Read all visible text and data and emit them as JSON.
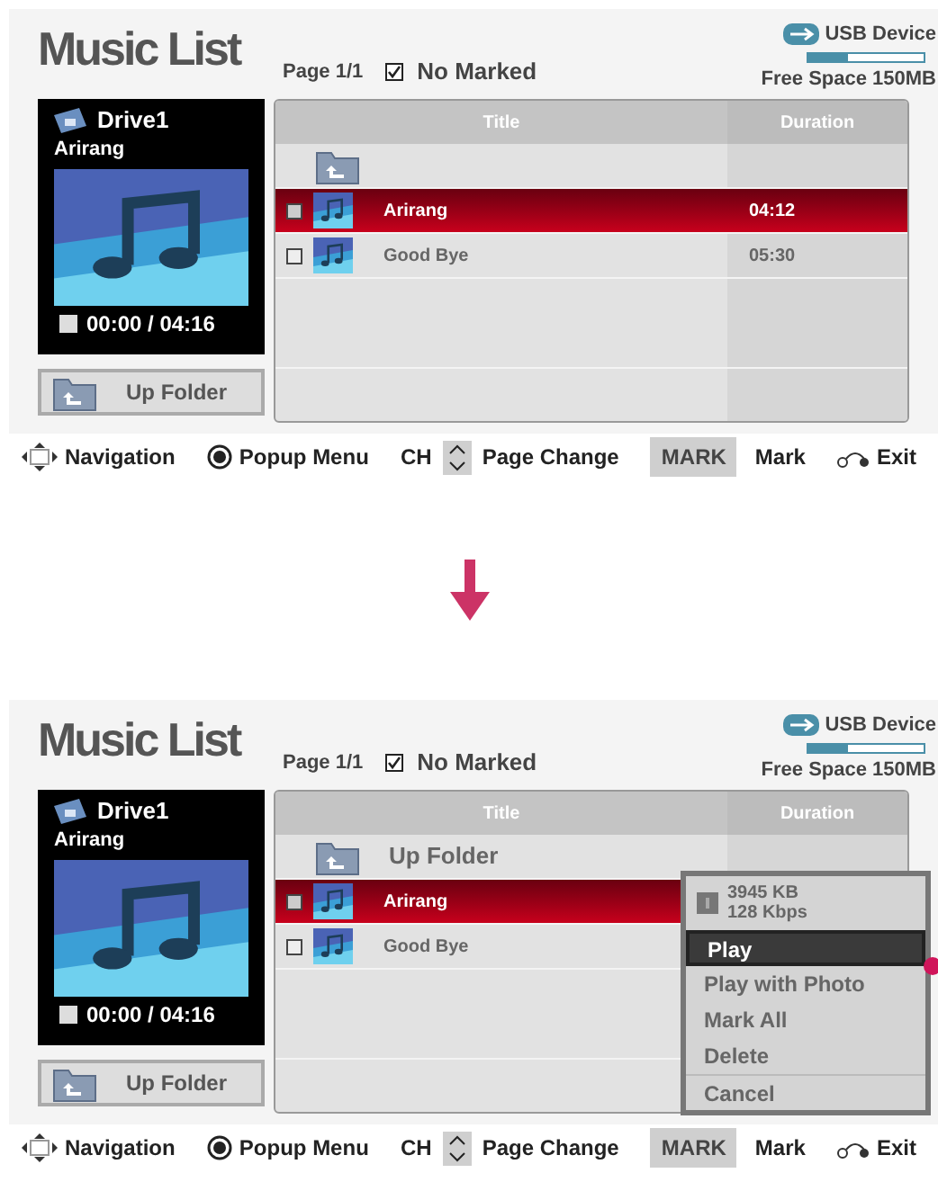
{
  "screens": [
    {
      "title": "Music List",
      "page": "Page 1/1",
      "marked_label": "No Marked",
      "usb": {
        "label": "USB Device",
        "level": 0.35,
        "free_space": "Free Space 150MB"
      },
      "now_playing": {
        "drive": "Drive1",
        "song": "Arirang",
        "time": "00:00 / 04:16"
      },
      "up_folder_button": "Up Folder",
      "columns": [
        "Title",
        "Duration"
      ],
      "rows": [
        {
          "kind": "folder",
          "selected": false
        },
        {
          "kind": "song",
          "title": "Arirang",
          "duration": "04:12",
          "selected": true
        },
        {
          "kind": "song",
          "title": "Good Bye",
          "duration": "05:30",
          "selected": false
        }
      ],
      "footer": [
        {
          "kind": "navigation",
          "label": "Navigation"
        },
        {
          "kind": "popup",
          "label": "Popup Menu"
        },
        {
          "kind": "page",
          "key": "CH",
          "label": "Page Change"
        },
        {
          "kind": "mark",
          "key": "MARK",
          "label": "Mark"
        },
        {
          "kind": "exit",
          "label": "Exit"
        }
      ]
    },
    {
      "title": "Music List",
      "page": "Page 1/1",
      "marked_label": "No Marked",
      "usb": {
        "label": "USB Device",
        "level": 0.35,
        "free_space": "Free Space 150MB"
      },
      "now_playing": {
        "drive": "Drive1",
        "song": "Arirang",
        "time": "00:00 / 04:16"
      },
      "up_folder_button": "Up Folder",
      "columns": [
        "Title",
        "Duration"
      ],
      "rows": [
        {
          "kind": "folder",
          "title": "Up Folder",
          "selected": false
        },
        {
          "kind": "song",
          "title": "Arirang",
          "selected": true
        },
        {
          "kind": "song",
          "title": "Good Bye",
          "selected": false
        }
      ],
      "popup": {
        "size": "3945 KB",
        "bitrate": "128 Kbps",
        "items": [
          {
            "label": "Play",
            "selected": true
          },
          {
            "label": "Play with Photo",
            "selected": false
          },
          {
            "label": "Mark All",
            "selected": false
          },
          {
            "label": "Delete",
            "selected": false
          },
          {
            "label": "Cancel",
            "selected": false
          }
        ]
      },
      "footer": [
        {
          "kind": "navigation",
          "label": "Navigation"
        },
        {
          "kind": "popup",
          "label": "Popup Menu"
        },
        {
          "kind": "page",
          "key": "CH",
          "label": "Page Change"
        },
        {
          "kind": "mark",
          "key": "MARK",
          "label": "Mark"
        },
        {
          "kind": "exit",
          "label": "Exit"
        }
      ]
    }
  ]
}
